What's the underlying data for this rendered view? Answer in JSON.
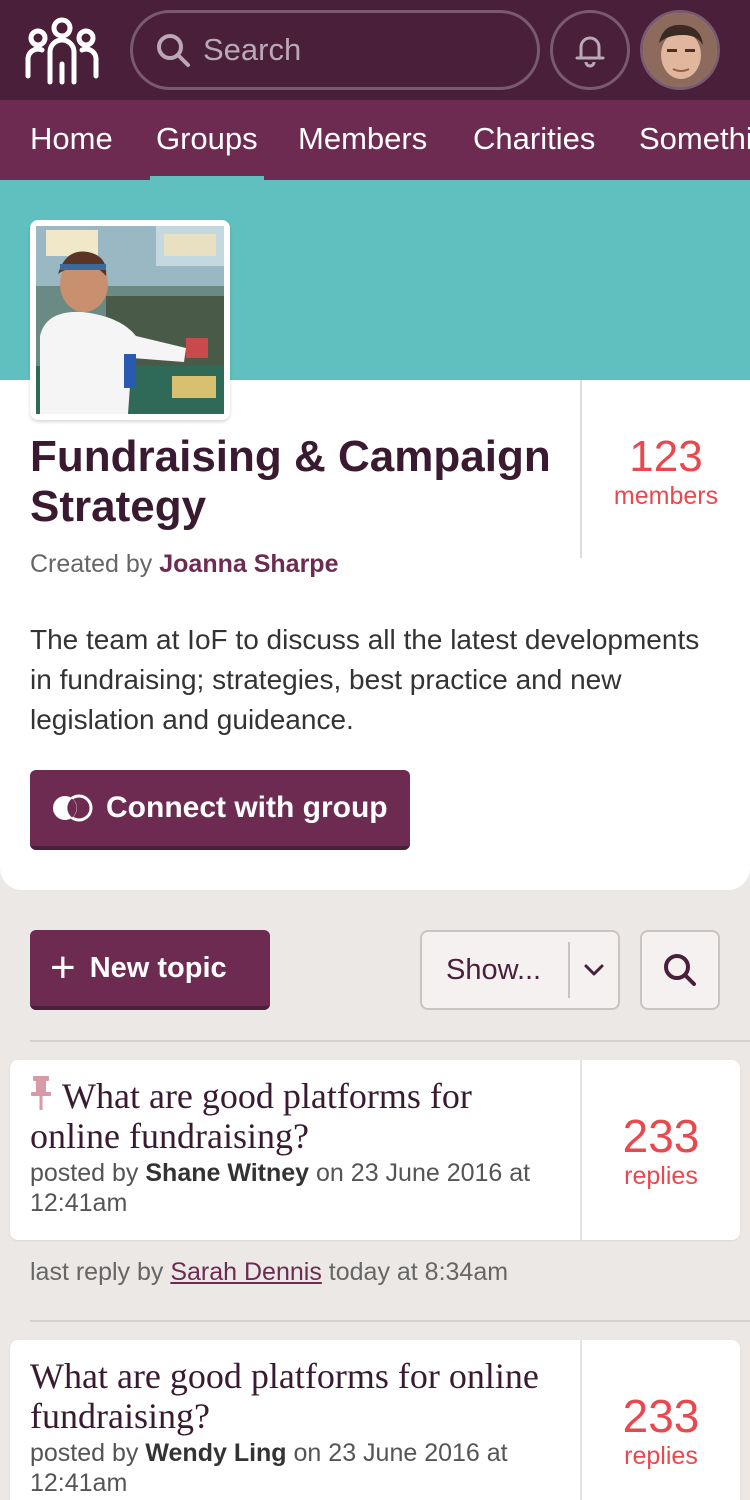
{
  "header": {
    "search_placeholder": "Search"
  },
  "nav": {
    "items": [
      "Home",
      "Groups",
      "Members",
      "Charities",
      "Something"
    ],
    "active": "Groups"
  },
  "group": {
    "title": "Fundraising & Campaign Strategy",
    "created_by_label": "Created by",
    "creator": "Joanna Sharpe",
    "description": "The team at IoF to discuss all the latest developments in fundraising; strategies, best practice and new legislation and guideance.",
    "members_count": "123",
    "members_label": "members",
    "connect_label": "Connect with group"
  },
  "toolbar": {
    "new_topic_label": "New topic",
    "show_label": "Show..."
  },
  "topics": [
    {
      "pinned": true,
      "title": "What are good platforms for online fundraising?",
      "posted_by_label": "posted by",
      "author": "Shane Witney",
      "date": "on 23 June 2016 at 12:41am",
      "replies": "233",
      "replies_label": "replies",
      "last_reply_prefix": "last reply by",
      "last_reply_user": "Sarah Dennis",
      "last_reply_time": "today at 8:34am"
    },
    {
      "pinned": false,
      "title": "What are good platforms for online fundraising?",
      "posted_by_label": "posted by",
      "author": "Wendy Ling",
      "date": "on 23 June 2016 at 12:41am",
      "replies": "233",
      "replies_label": "replies"
    }
  ],
  "colors": {
    "topbar": "#4a1f3a",
    "nav": "#6d2b52",
    "banner": "#5fc0bf",
    "accent_red": "#e8484e",
    "button": "#6d2b52"
  }
}
